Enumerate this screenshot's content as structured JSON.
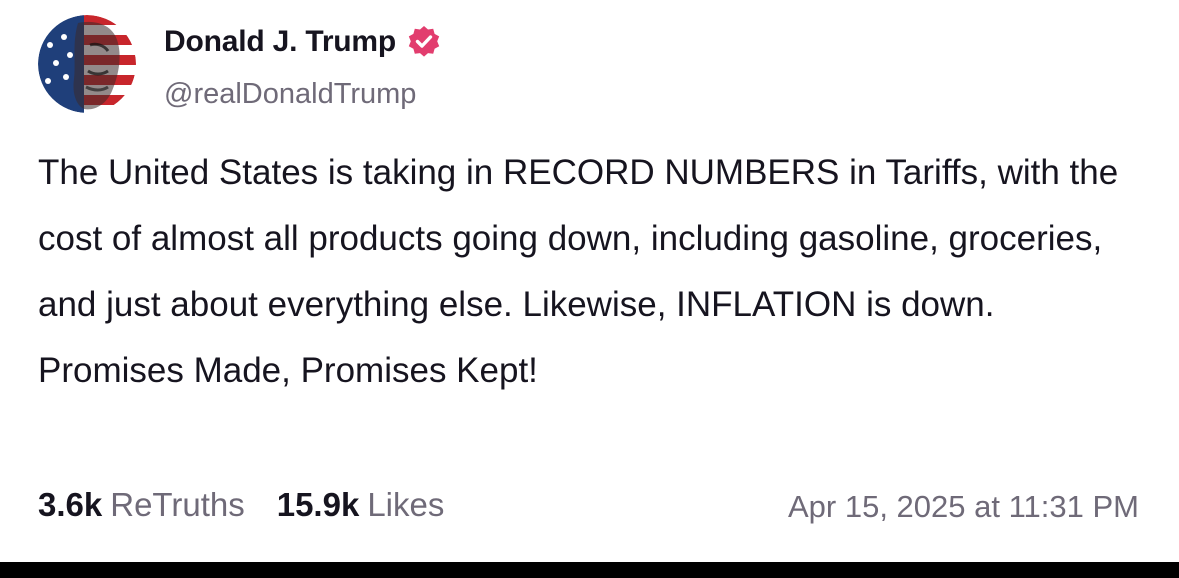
{
  "author": {
    "display_name": "Donald J. Trump",
    "handle": "@realDonaldTrump",
    "verified_icon": "verified-check-icon",
    "verified_color": "#e23d6e"
  },
  "post": {
    "text": "The United States is taking in RECORD NUMBERS in Tariffs, with the cost of almost all products going down, including gasoline, groceries, and just about everything else. Likewise, INFLATION is down. Promises Made, Promises Kept!"
  },
  "stats": {
    "retruths_count": "3.6k",
    "retruths_label": "ReTruths",
    "likes_count": "15.9k",
    "likes_label": "Likes"
  },
  "timestamp": "Apr 15, 2025 at 11:31 PM",
  "colors": {
    "text_primary": "#16141f",
    "text_secondary": "#6f6a78",
    "background": "#ffffff",
    "bottom_bar": "#000000"
  }
}
